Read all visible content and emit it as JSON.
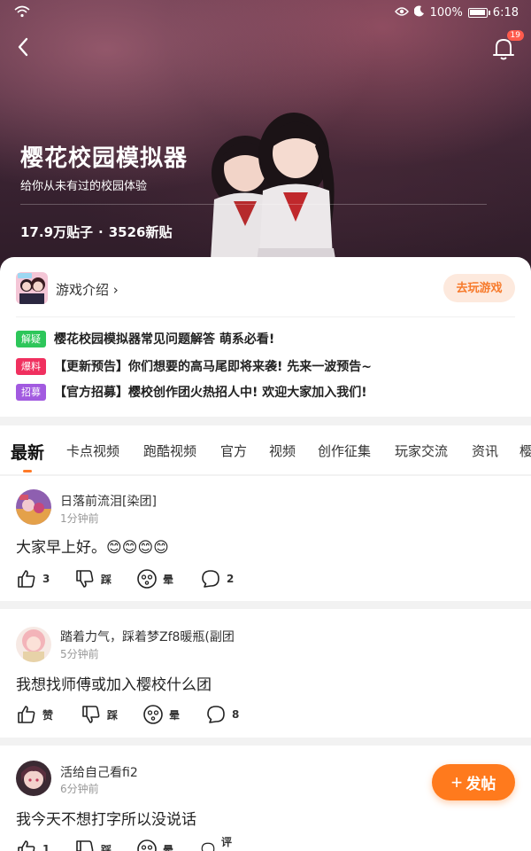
{
  "status_bar": {
    "battery": "100%",
    "time": "6:18"
  },
  "header": {
    "notification_count": "19"
  },
  "hero": {
    "title": "樱花校园模拟器",
    "subtitle": "给你从未有过的校园体验",
    "posts_count": "17.9万贴子",
    "separator": "·",
    "new_posts": "3526新贴"
  },
  "game_card": {
    "intro_label": "游戏介绍",
    "chevron": "›",
    "play_label": "去玩游戏"
  },
  "notices": [
    {
      "tag": "解疑",
      "color": "#2dc65a",
      "text": "樱花校园模拟器常见问题解答 萌系必看!"
    },
    {
      "tag": "爆料",
      "color": "#f0305f",
      "text": "【更新预告】你们想要的高马尾即将来袭! 先来一波预告~"
    },
    {
      "tag": "招募",
      "color": "#a25ae0",
      "text": "【官方招募】樱校创作团火热招人中! 欢迎大家加入我们!"
    }
  ],
  "tabs": [
    "最新",
    "卡点视频",
    "跑酷视频",
    "官方",
    "视频",
    "创作征集",
    "玩家交流",
    "资讯",
    "樱"
  ],
  "posts": [
    {
      "user": "日落前流泪[染团]",
      "time": "1分钟前",
      "content": "大家早上好。😊😊😊😊",
      "like": "3",
      "dislike": "踩",
      "dizzy": "晕",
      "comment": "2"
    },
    {
      "user": "踏着力气，踩着梦Zf8暖瓶(副团",
      "time": "5分钟前",
      "content": "我想找师傅或加入樱校什么团",
      "like": "赞",
      "dislike": "踩",
      "dizzy": "晕",
      "comment": "8"
    },
    {
      "user": "活给自己看fi2",
      "time": "6分钟前",
      "content": "我今天不想打字所以没说话",
      "like": "1",
      "dislike": "踩",
      "dizzy": "晕",
      "comment": "评论"
    }
  ],
  "fab": {
    "plus": "+",
    "label": "发帖"
  },
  "accent_color": "#ff7a1d"
}
